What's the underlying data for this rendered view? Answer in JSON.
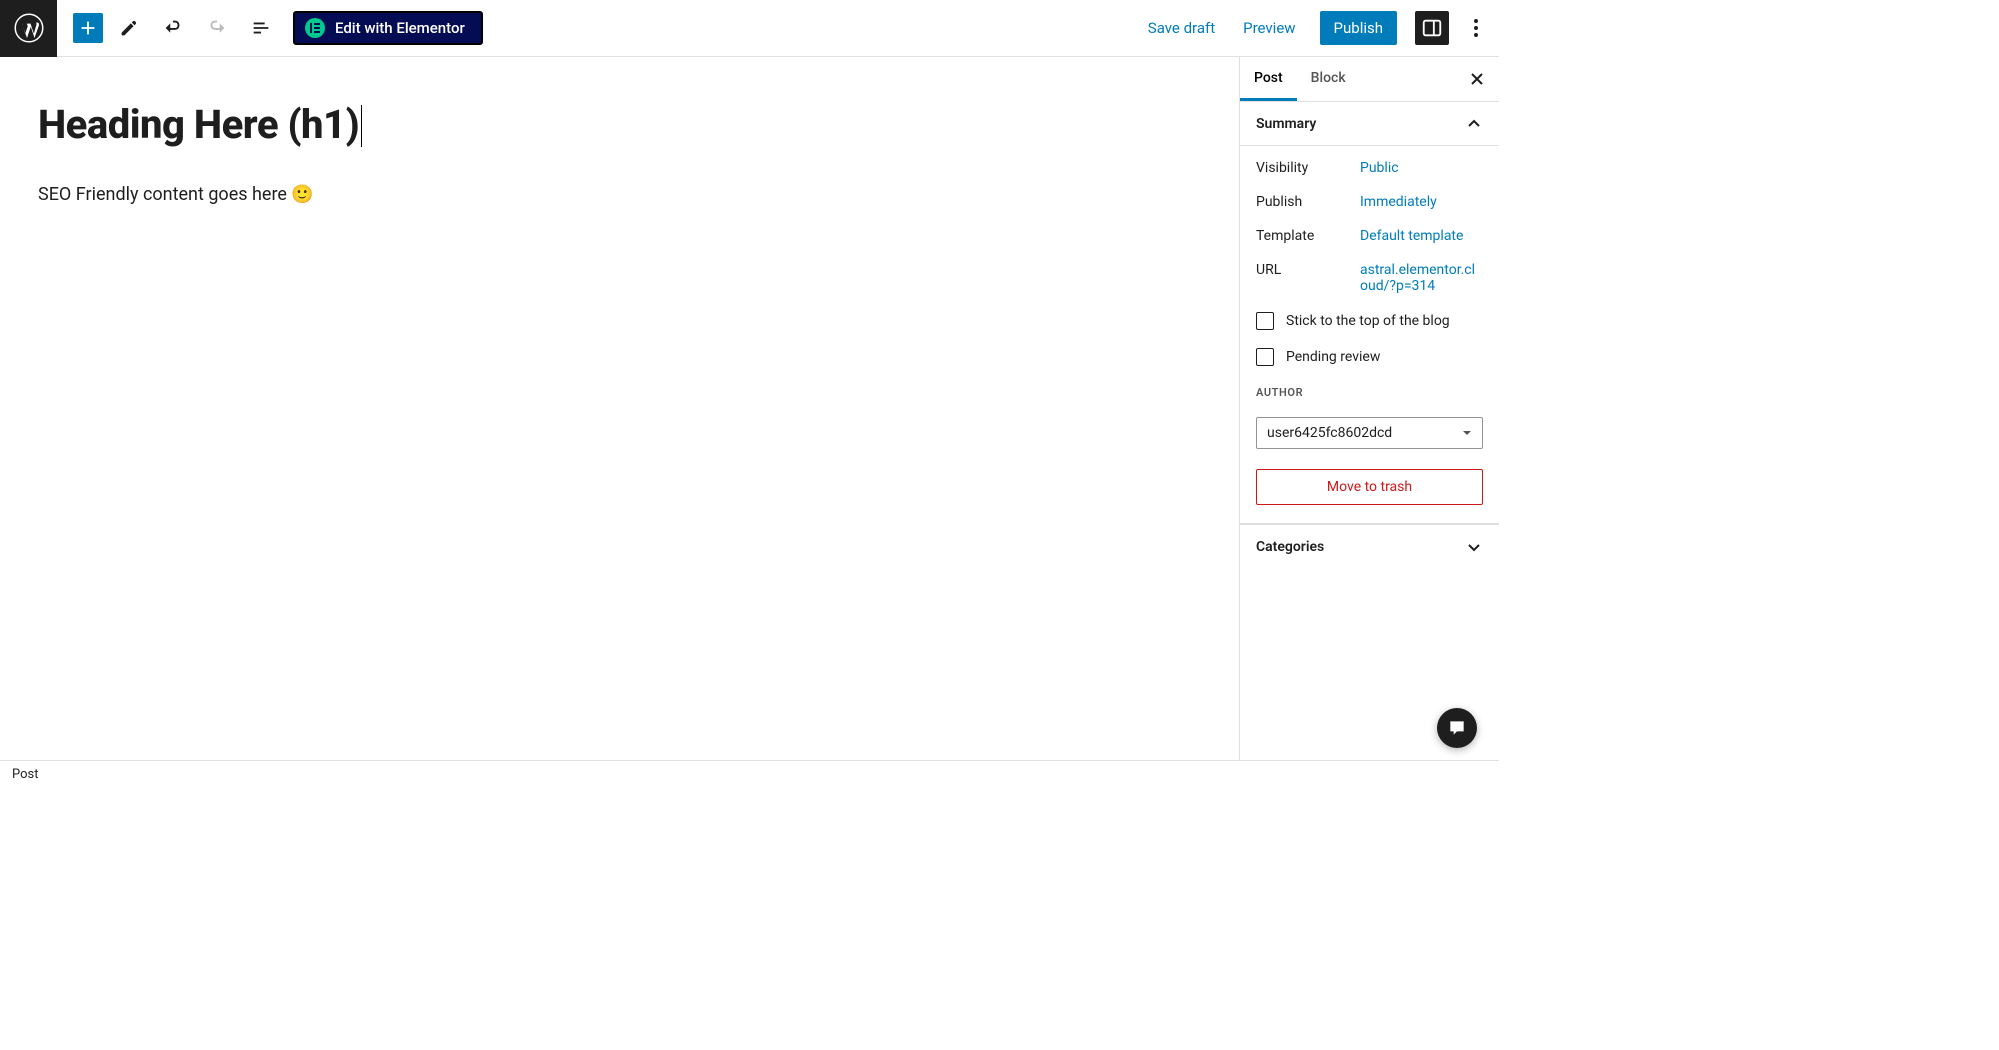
{
  "toolbar": {
    "elementor_label": "Edit with Elementor",
    "save_draft": "Save draft",
    "preview": "Preview",
    "publish": "Publish"
  },
  "editor": {
    "heading": "Heading Here (h1)",
    "content": "SEO Friendly content goes here 🙂"
  },
  "sidebar": {
    "tabs": {
      "post": "Post",
      "block": "Block"
    },
    "summary": {
      "title": "Summary",
      "visibility_label": "Visibility",
      "visibility_value": "Public",
      "publish_label": "Publish",
      "publish_value": "Immediately",
      "template_label": "Template",
      "template_value": "Default template",
      "url_label": "URL",
      "url_value": "astral.elementor.cloud/?p=314",
      "stick_label": "Stick to the top of the blog",
      "pending_label": "Pending review",
      "author_label": "AUTHOR",
      "author_value": "user6425fc8602dcd",
      "trash_label": "Move to trash"
    },
    "categories": {
      "title": "Categories"
    }
  },
  "footer": {
    "breadcrumb": "Post"
  }
}
